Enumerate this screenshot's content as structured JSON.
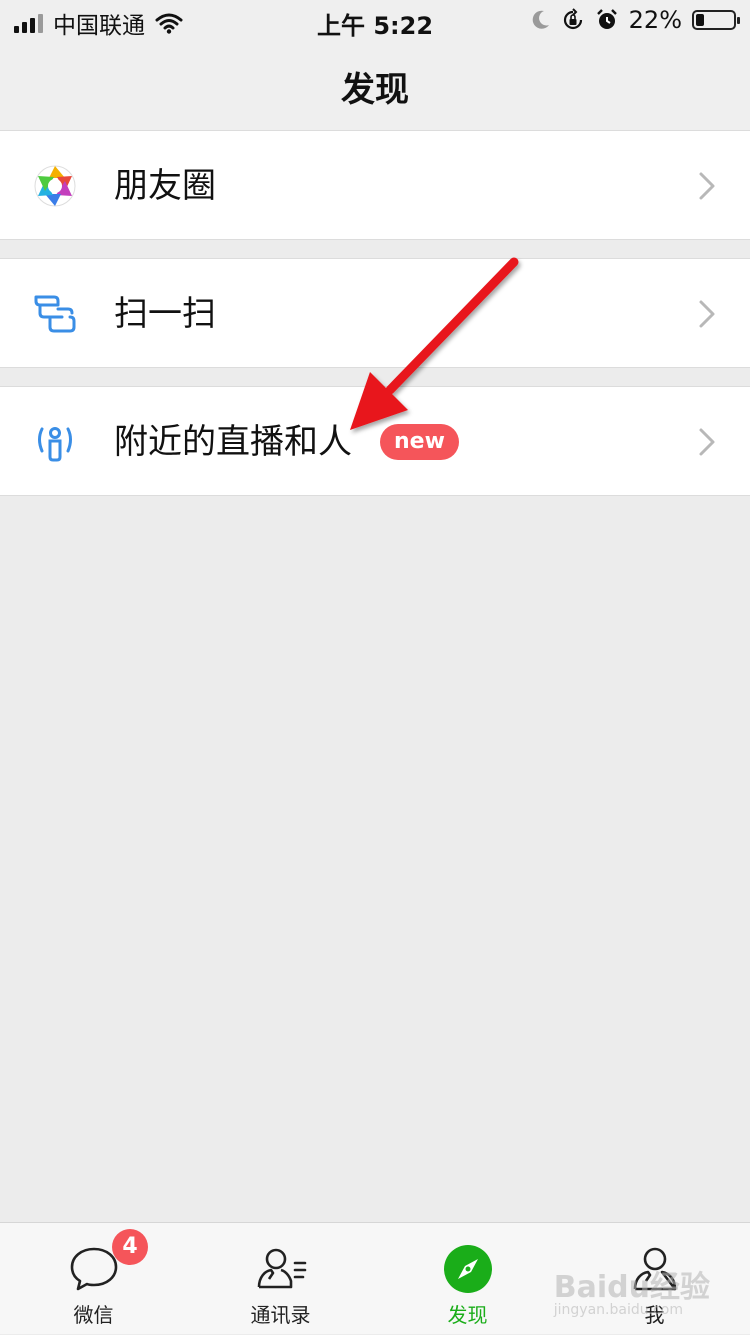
{
  "status_bar": {
    "carrier": "中国联通",
    "time": "上午 5:22",
    "battery_percent": "22%",
    "battery_level": 0.22,
    "icons": [
      "signal-icon",
      "wifi-icon",
      "moon-icon",
      "rotation-lock-icon",
      "alarm-icon",
      "battery-icon"
    ]
  },
  "nav": {
    "title": "发现"
  },
  "menu": {
    "items": [
      {
        "label": "朋友圈",
        "icon": "moments-icon"
      },
      {
        "label": "扫一扫",
        "icon": "scan-icon"
      },
      {
        "label": "附近的直播和人",
        "icon": "nearby-icon",
        "badge": "new"
      }
    ]
  },
  "tabs": [
    {
      "label": "微信",
      "icon": "chat-icon",
      "badge": "4"
    },
    {
      "label": "通讯录",
      "icon": "contacts-icon"
    },
    {
      "label": "发现",
      "icon": "discover-icon",
      "active": true
    },
    {
      "label": "我",
      "icon": "me-icon"
    }
  ],
  "watermark": {
    "brand": "Baidu经验",
    "url": "jingyan.baidu.com"
  },
  "colors": {
    "accent_green": "#1aad19",
    "badge_red": "#f5555a",
    "icon_blue": "#3a8ee6",
    "arrow_red": "#e8141b"
  }
}
